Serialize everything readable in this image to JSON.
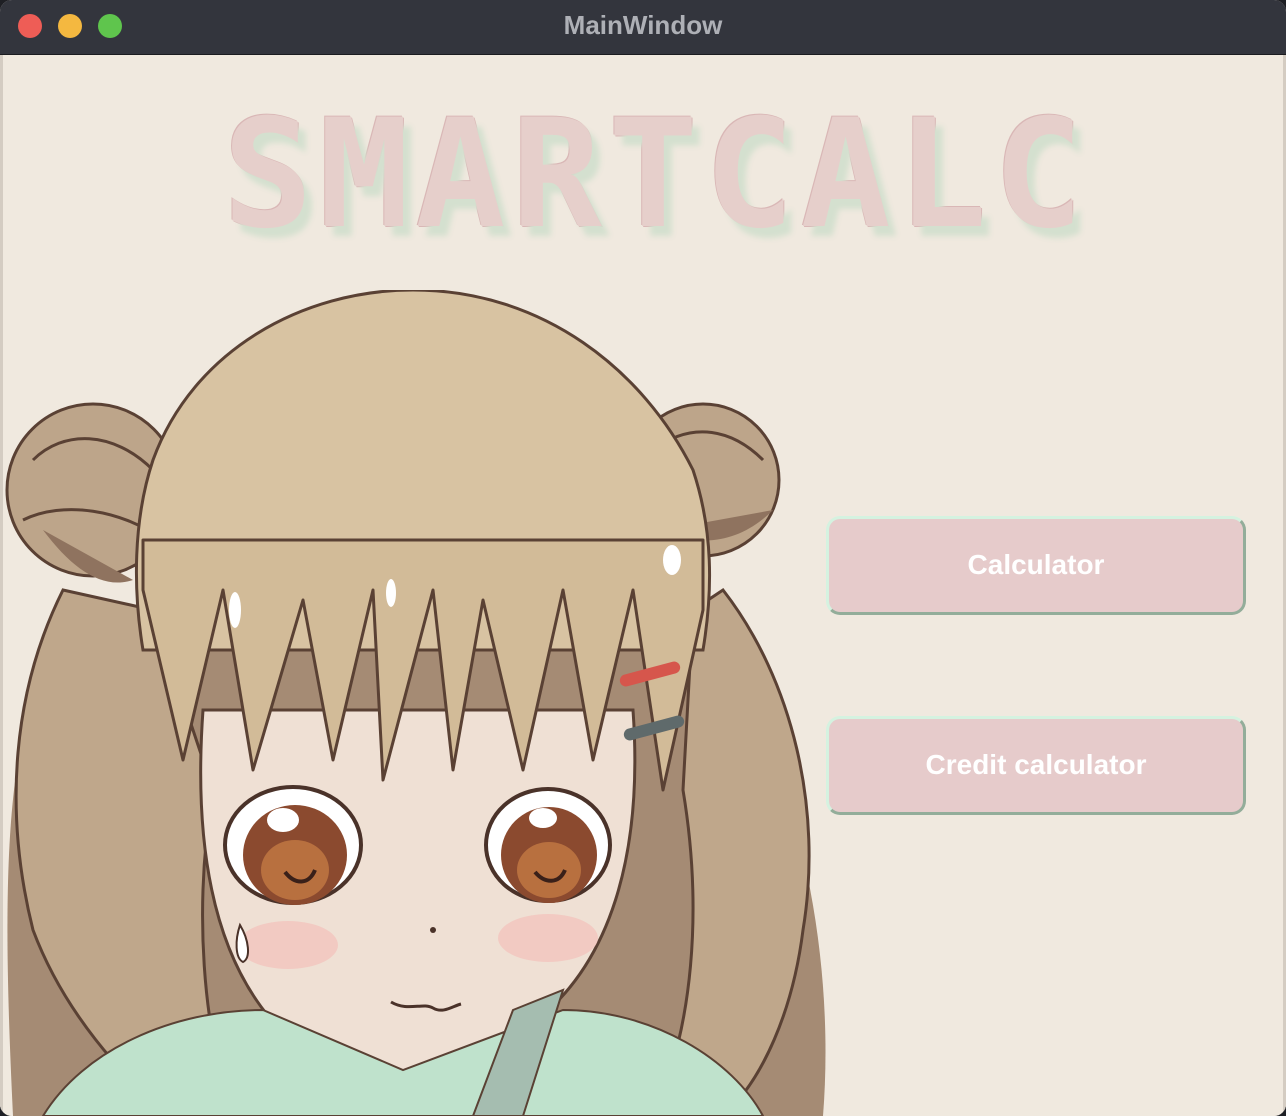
{
  "window": {
    "title": "MainWindow"
  },
  "logo": {
    "text": "SMARTCALC"
  },
  "buttons": {
    "calculator_label": "Calculator",
    "credit_calculator_label": "Credit calculator"
  },
  "colors": {
    "background": "#f0e9df",
    "titlebar": "#33353d",
    "button_fill": "#e6cbcb",
    "button_text": "#ffffff",
    "logo_fill": "#e6cfcb"
  }
}
